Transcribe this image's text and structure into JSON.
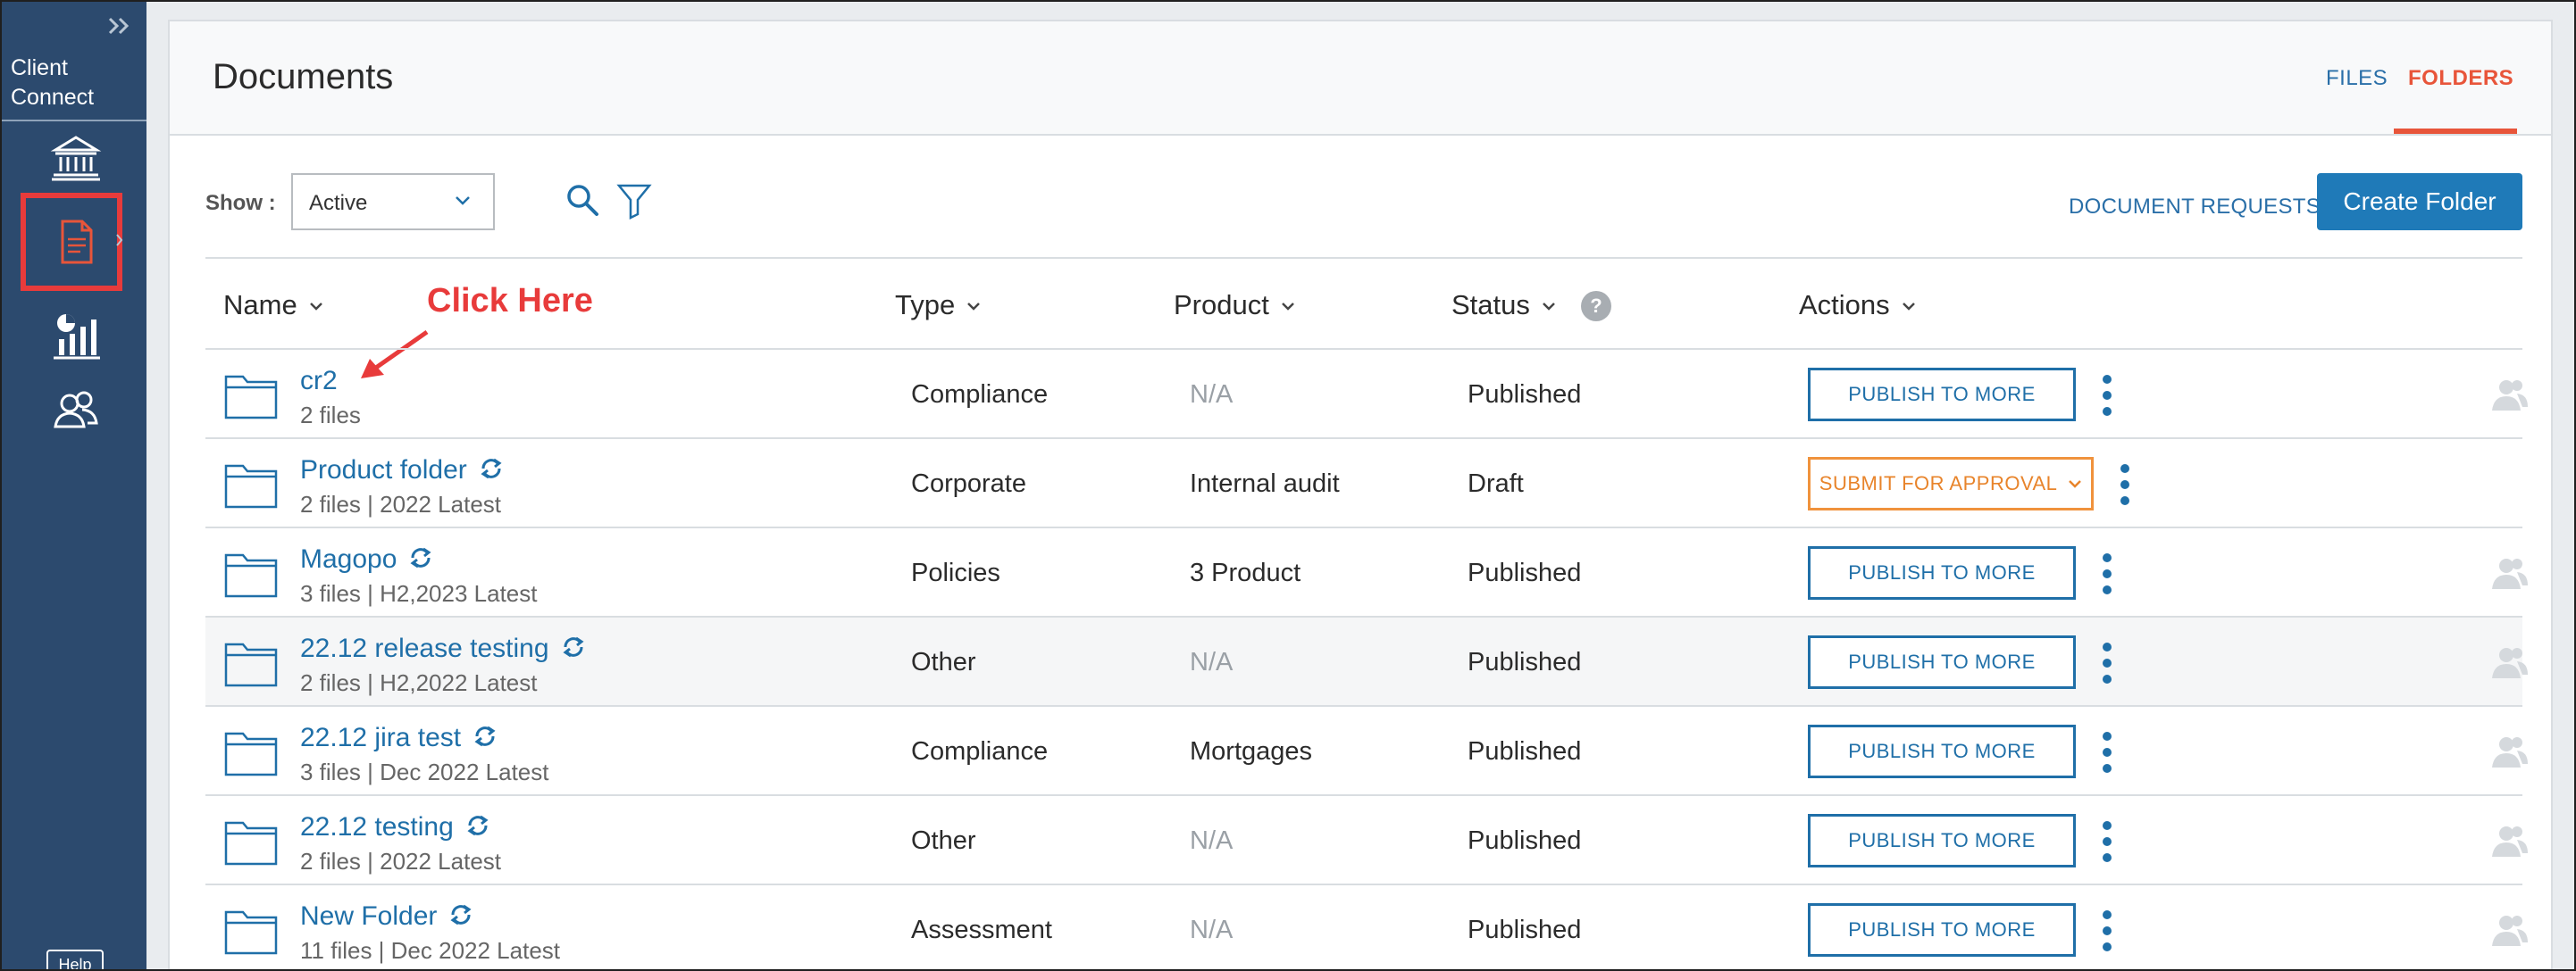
{
  "sidebar": {
    "brand_line1": "Client",
    "brand_line2": "Connect",
    "help_label": "Help"
  },
  "header": {
    "title": "Documents",
    "tabs": [
      {
        "label": "FILES",
        "active": false
      },
      {
        "label": "FOLDERS",
        "active": true
      }
    ]
  },
  "toolbar": {
    "show_label": "Show :",
    "show_value": "Active",
    "document_requests": "DOCUMENT REQUESTS",
    "create_folder": "Create Folder"
  },
  "table": {
    "columns": [
      "Name",
      "Type",
      "Product",
      "Status",
      "Actions"
    ],
    "annotation": "Click Here",
    "rows": [
      {
        "name": "cr2",
        "meta": "2 files",
        "type": "Compliance",
        "product": "N/A",
        "status": "Published",
        "action": "PUBLISH TO MORE"
      },
      {
        "name": "Product folder",
        "meta": "2 files | 2022 Latest",
        "type": "Corporate",
        "product": "Internal audit",
        "status": "Draft",
        "action": "SUBMIT FOR APPROVAL"
      },
      {
        "name": "Magopo",
        "meta": "3 files | H2,2023 Latest",
        "type": "Policies",
        "product": "3 Product",
        "status": "Published",
        "action": "PUBLISH TO MORE"
      },
      {
        "name": "22.12 release testing",
        "meta": "2 files | H2,2022 Latest",
        "type": "Other",
        "product": "N/A",
        "status": "Published",
        "action": "PUBLISH TO MORE"
      },
      {
        "name": "22.12 jira test",
        "meta": "3 files | Dec 2022 Latest",
        "type": "Compliance",
        "product": "Mortgages",
        "status": "Published",
        "action": "PUBLISH TO MORE"
      },
      {
        "name": "22.12 testing",
        "meta": "2 files | 2022 Latest",
        "type": "Other",
        "product": "N/A",
        "status": "Published",
        "action": "PUBLISH TO MORE"
      },
      {
        "name": "New Folder",
        "meta": "11 files | Dec 2022 Latest",
        "type": "Assessment",
        "product": "N/A",
        "status": "Published",
        "action": "PUBLISH TO MORE"
      }
    ]
  },
  "colors": {
    "sidebar": "#2c4a6e",
    "accent_blue": "#1f6fa8",
    "accent_orange": "#e8553a",
    "highlight_red": "#e83b3b"
  },
  "icons": [
    "collapse-icon",
    "bank-icon",
    "document-icon",
    "report-icon",
    "users-icon",
    "search-icon",
    "filter-icon",
    "folder-icon",
    "sync-icon",
    "kebab-icon",
    "user-icon",
    "mail-icon",
    "help-icon",
    "chevron-down-icon"
  ]
}
